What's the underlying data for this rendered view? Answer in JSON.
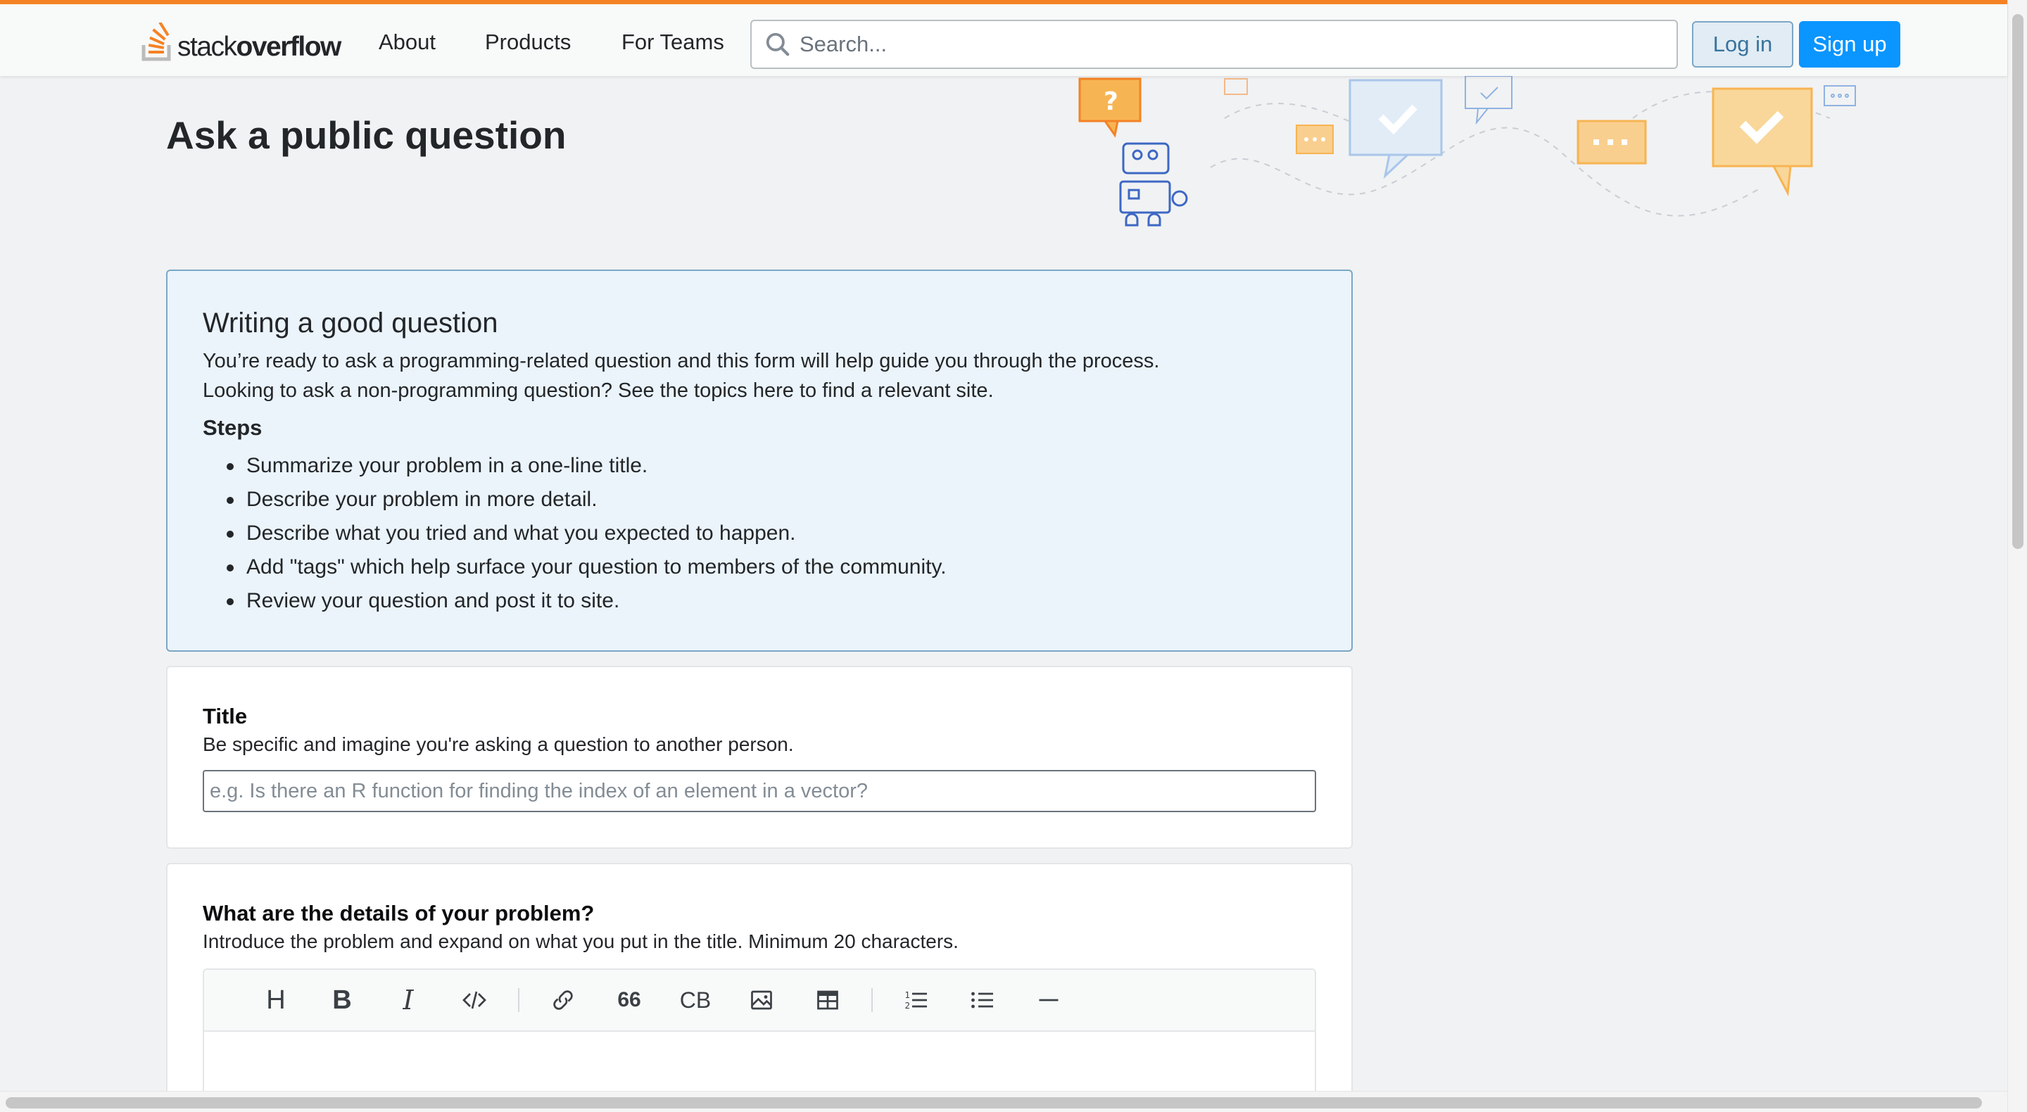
{
  "header": {
    "logo_light": "stack",
    "logo_bold": "overflow",
    "nav": [
      "About",
      "Products",
      "For Teams"
    ],
    "search_placeholder": "Search...",
    "login_label": "Log in",
    "signup_label": "Sign up"
  },
  "page": {
    "title": "Ask a public question"
  },
  "notice": {
    "heading": "Writing a good question",
    "line1": "You’re ready to ask a programming-related question and this form will help guide you through the process.",
    "line2": "Looking to ask a non-programming question? See the topics here to find a relevant site.",
    "steps_heading": "Steps",
    "steps": [
      "Summarize your problem in a one-line title.",
      "Describe your problem in more detail.",
      "Describe what you tried and what you expected to happen.",
      "Add \"tags\" which help surface your question to members of the community.",
      "Review your question and post it to site."
    ]
  },
  "title_card": {
    "label": "Title",
    "description": "Be specific and imagine you're asking a question to another person.",
    "placeholder": "e.g. Is there an R function for finding the index of an element in a vector?"
  },
  "details_card": {
    "label": "What are the details of your problem?",
    "description": "Introduce the problem and expand on what you put in the title. Minimum 20 characters.",
    "toolbar": {
      "heading": "H",
      "bold": "B",
      "italic": "I",
      "quote": "66",
      "codeblock": "CB"
    }
  },
  "colors": {
    "accent_orange": "#f48225",
    "primary_blue": "#0a95ff",
    "notice_bg": "#ebf4fb"
  }
}
